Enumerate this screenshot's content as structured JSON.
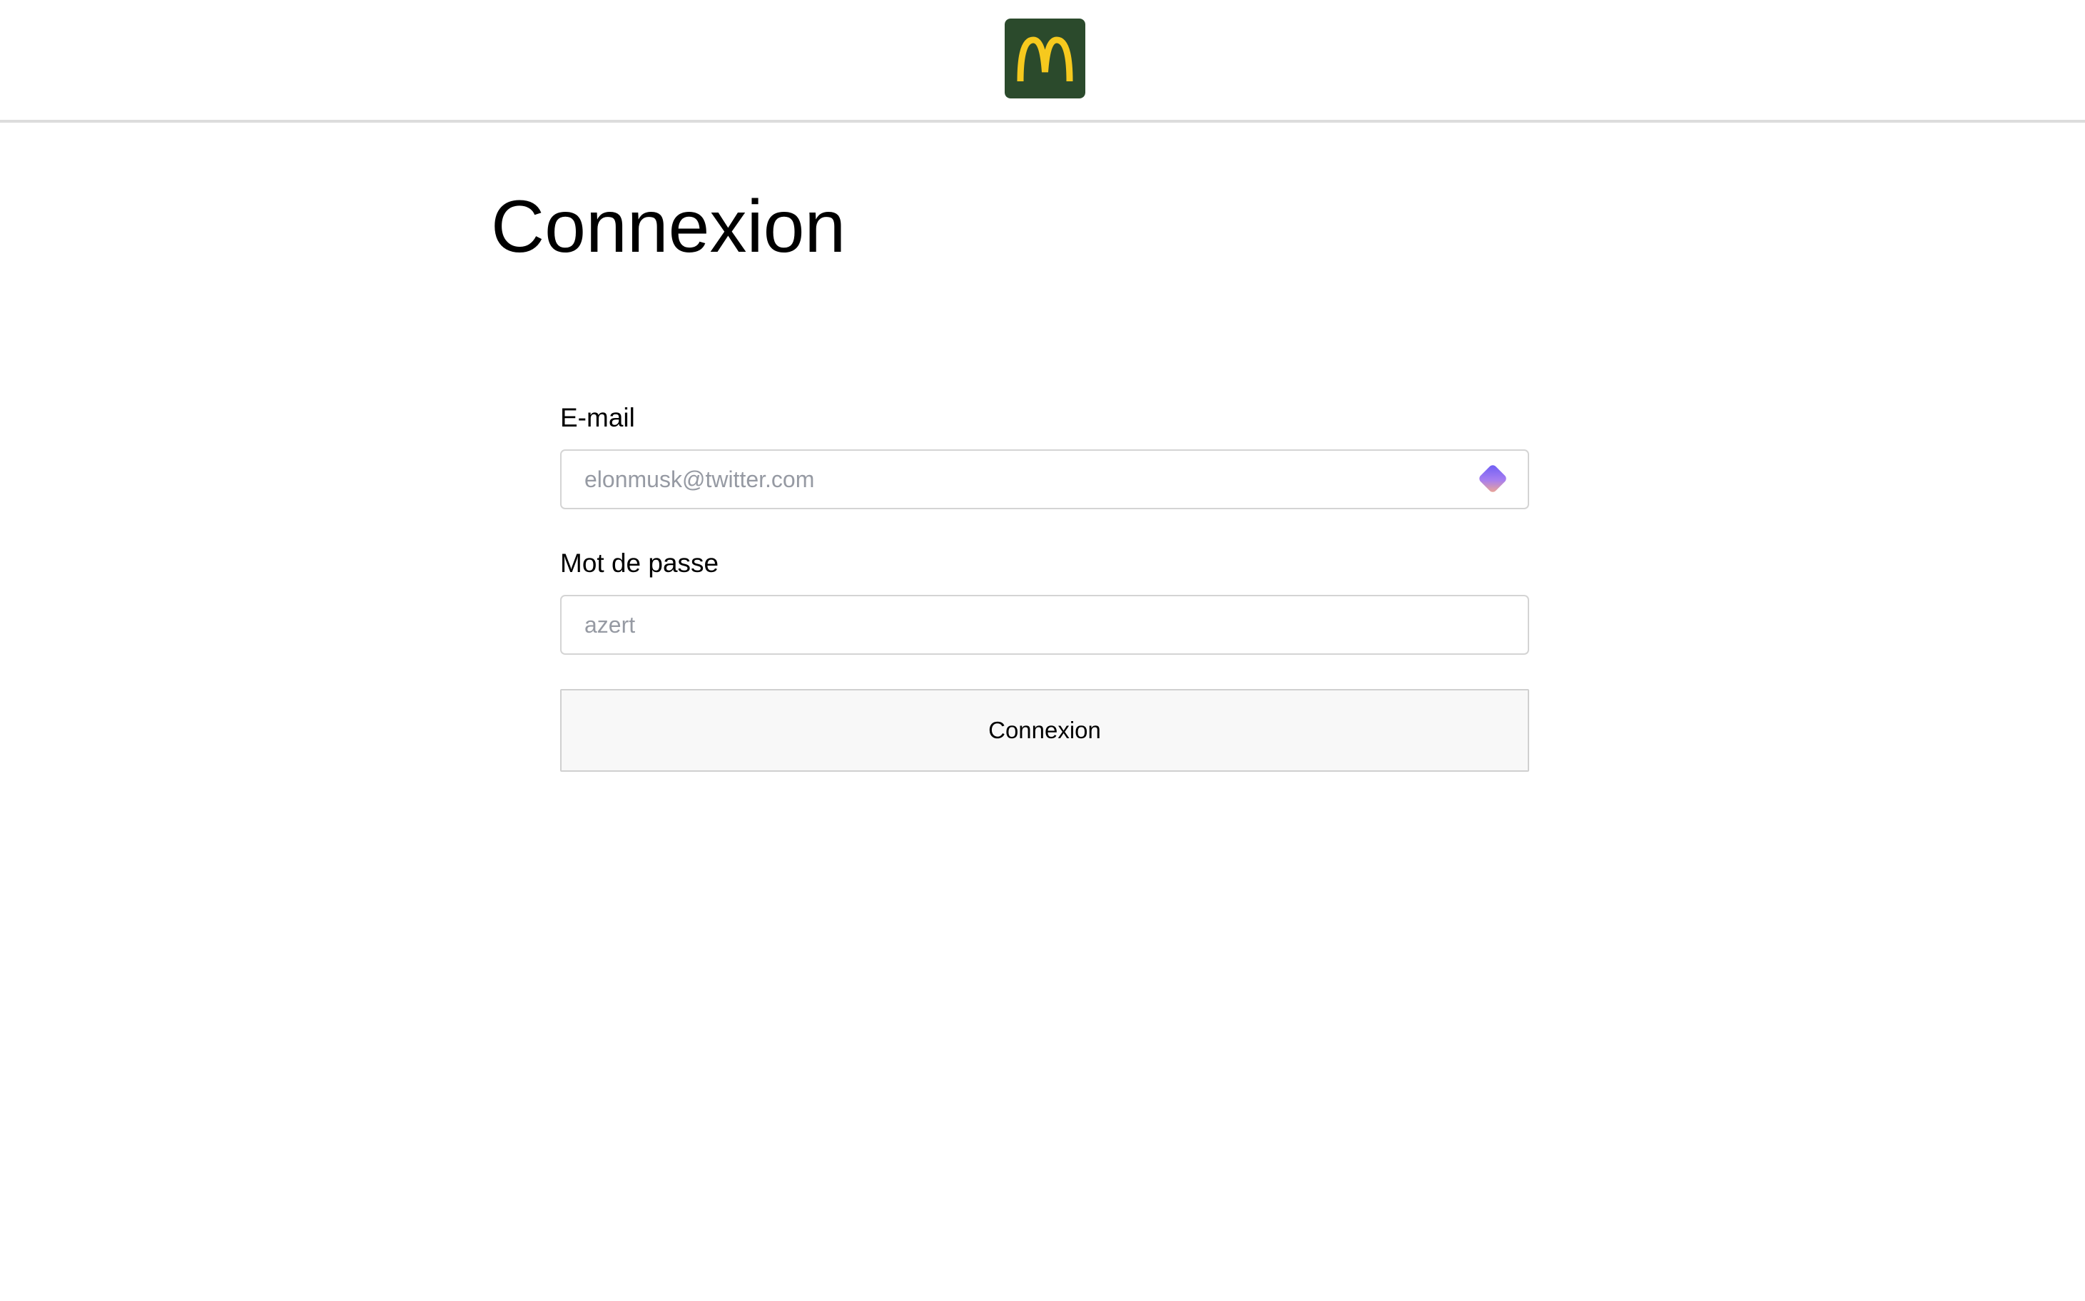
{
  "header": {
    "logo_icon": "mcdonalds-golden-arches-logo-icon",
    "logo_bg_color": "#2b4a2c",
    "logo_arch_color": "#f6c91e"
  },
  "page": {
    "title": "Connexion"
  },
  "form": {
    "email_label": "E-mail",
    "email_placeholder": "elonmusk@twitter.com",
    "email_value": "",
    "password_manager_icon": "password-manager-icon",
    "password_label": "Mot de passe",
    "password_placeholder": "azert",
    "password_value": "",
    "submit_label": "Connexion"
  }
}
